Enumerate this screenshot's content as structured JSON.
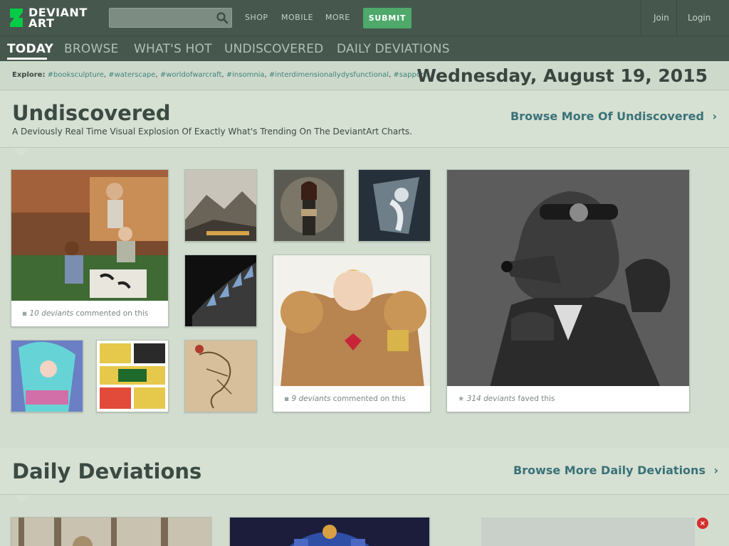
{
  "header": {
    "logo_line1": "DEVIANT",
    "logo_line2": "ART",
    "search_placeholder": "",
    "nav": [
      "SHOP",
      "MOBILE",
      "MORE"
    ],
    "submit_label": "SUBMIT",
    "join_label": "Join",
    "login_label": "Login"
  },
  "tabs": [
    {
      "label": "TODAY",
      "active": true
    },
    {
      "label": "BROWSE",
      "active": false
    },
    {
      "label": "WHAT'S HOT",
      "active": false
    },
    {
      "label": "UNDISCOVERED",
      "active": false
    },
    {
      "label": "DAILY DEVIATIONS",
      "active": false
    }
  ],
  "explore": {
    "label": "Explore:",
    "tags": [
      "#booksculpture",
      "#waterscape",
      "#worldofwarcraft",
      "#insomnia",
      "#interdimensionallydysfunctional",
      "#sapporo"
    ]
  },
  "date": "Wednesday, August 19, 2015",
  "undiscovered": {
    "title": "Undiscovered",
    "subtitle": "A Deviously Real Time Visual Explosion Of Exactly What's Trending On The DeviantArt Charts.",
    "more_label": "Browse More Of Undiscovered",
    "meta1_count": "10 deviants",
    "meta1_text": " commented on this",
    "meta2_count": "9 deviants",
    "meta2_text": " commented on this",
    "meta3_count": "314 deviants",
    "meta3_text": " faved this"
  },
  "daily": {
    "title": "Daily Deviations",
    "more_label": "Browse More Daily Deviations"
  },
  "colors": {
    "header_bg": "#46574e",
    "page_bg": "#d2ddd0",
    "accent_green": "#4ea96b",
    "link_teal": "#3a7278"
  }
}
